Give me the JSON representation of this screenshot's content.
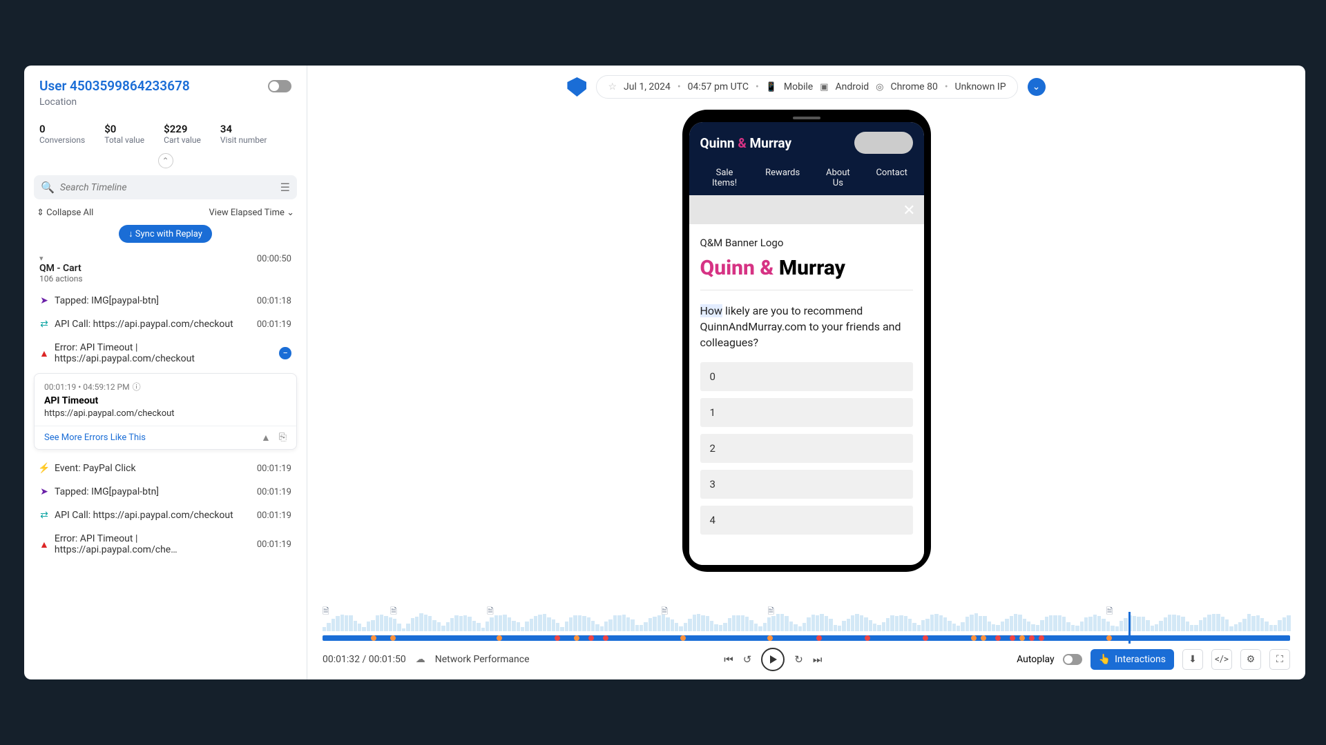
{
  "sidebar": {
    "user_label": "User 4503599864233678",
    "location_label": "Location",
    "stats": {
      "conversions_val": "0",
      "conversions_lbl": "Conversions",
      "total_val": "$0",
      "total_lbl": "Total value",
      "cart_val": "$229",
      "cart_lbl": "Cart value",
      "visit_val": "34",
      "visit_lbl": "Visit number"
    },
    "search_placeholder": "Search Timeline",
    "collapse_label": "Collapse All",
    "view_label": "View Elapsed Time",
    "sync_label": "↓ Sync with Replay",
    "group": {
      "title": "QM - Cart",
      "sub": "106 actions",
      "time": "00:00:50"
    },
    "rows": [
      {
        "kind": "cursor",
        "text": "Tapped: IMG[paypal-btn]",
        "time": "00:01:18"
      },
      {
        "kind": "net",
        "text": "API Call: https://api.paypal.com/checkout",
        "time": "00:01:19"
      },
      {
        "kind": "err",
        "text": "Error: API Timeout | https://api.paypal.com/checkout",
        "time": ""
      },
      {
        "kind": "event",
        "text": "Event: PayPal Click",
        "time": "00:01:19"
      },
      {
        "kind": "cursor",
        "text": "Tapped: IMG[paypal-btn]",
        "time": "00:01:19"
      },
      {
        "kind": "net",
        "text": "API Call: https://api.paypal.com/checkout",
        "time": "00:01:19"
      },
      {
        "kind": "err",
        "text": "Error: API Timeout | https://api.paypal.com/che…",
        "time": "00:01:19"
      }
    ],
    "err_card": {
      "meta": "00:01:19 • 04:59:12 PM",
      "title": "API Timeout",
      "url": "https://api.paypal.com/checkout",
      "see_more": "See More Errors Like This"
    }
  },
  "topbar": {
    "date": "Jul 1, 2024",
    "time": "04:57 pm UTC",
    "device": "Mobile",
    "os": "Android",
    "browser": "Chrome 80",
    "ip": "Unknown IP"
  },
  "phone": {
    "brand_quinn": "Quinn",
    "brand_amp": "&",
    "brand_murray": "Murray",
    "nav1": "Sale Items!",
    "nav2": "Rewards",
    "nav3": "About Us",
    "nav4": "Contact",
    "banner": "Q&M Banner Logo",
    "brand_big_a": "Quinn &",
    "brand_big_b": "Murray",
    "question": "How likely are you to recommend QuinnAndMurray.com to your friends and colleagues?",
    "opts": [
      "0",
      "1",
      "2",
      "3",
      "4"
    ]
  },
  "footer": {
    "time": "00:01:32 / 00:01:50",
    "net": "Network Performance",
    "autoplay": "Autoplay",
    "interactions": "Interactions"
  }
}
